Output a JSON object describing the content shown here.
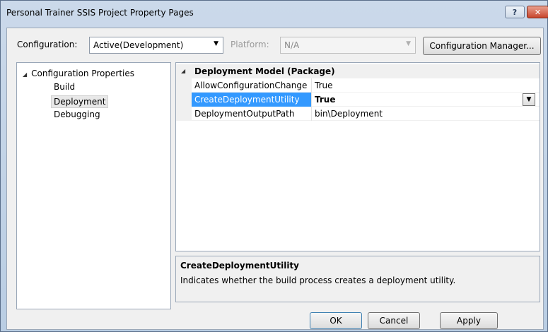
{
  "window": {
    "title": "Personal Trainer SSIS Project Property Pages",
    "help_glyph": "?",
    "close_glyph": "✕"
  },
  "toolbar": {
    "configuration_label": "Configuration:",
    "configuration_value": "Active(Development)",
    "platform_label": "Platform:",
    "platform_value": "N/A",
    "configuration_manager_label": "Configuration Manager...",
    "dropdown_glyph": "▼"
  },
  "tree": {
    "root_expander": "◢",
    "root_label": "Configuration Properties",
    "items": [
      {
        "label": "Build"
      },
      {
        "label": "Deployment",
        "selected": true
      },
      {
        "label": "Debugging"
      }
    ]
  },
  "grid": {
    "category_expander": "◢",
    "category_title": "Deployment Model (Package)",
    "rows": [
      {
        "name": "AllowConfigurationChange",
        "value": "True"
      },
      {
        "name": "CreateDeploymentUtility",
        "value": "True",
        "selected": true
      },
      {
        "name": "DeploymentOutputPath",
        "value": "bin\\Deployment"
      }
    ],
    "dropdown_glyph": "▼"
  },
  "description": {
    "title": "CreateDeploymentUtility",
    "text": "Indicates whether the build process creates a deployment utility."
  },
  "buttons": {
    "ok": "OK",
    "cancel": "Cancel",
    "apply": "Apply"
  },
  "colors": {
    "selection": "#3399ff",
    "close_button": "#c8452c",
    "title_bar": "#cbd9ea"
  }
}
